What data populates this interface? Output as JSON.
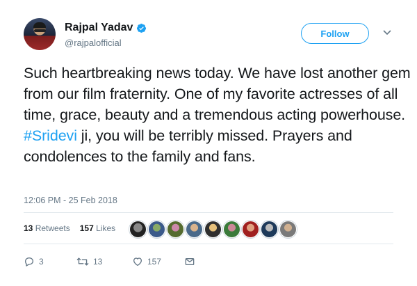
{
  "author": {
    "name": "Rajpal Yadav",
    "handle": "@rajpalofficial",
    "verified": true
  },
  "follow_label": "Follow",
  "tweet": {
    "text_before": "Such heartbreaking news today. We have lost another gem from our film fraternity. One of my favorite actresses of all time, grace, beauty and a tremendous acting powerhouse. ",
    "hashtag": "#Sridevi",
    "text_after": " ji, you will be terribly missed. Prayers and condolences to the family and fans."
  },
  "timestamp": "12:06 PM - 25 Feb 2018",
  "stats": {
    "retweets_count": "13",
    "retweets_label": "Retweets",
    "likes_count": "157",
    "likes_label": "Likes"
  },
  "likers_count": 9,
  "actions": {
    "reply_count": "3",
    "retweet_count": "13",
    "like_count": "157"
  },
  "colors": {
    "accent": "#1da1f2",
    "secondary_text": "#657786",
    "divider": "#e1e8ed"
  },
  "icons": [
    "verified-badge-icon",
    "chevron-down-icon",
    "reply-icon",
    "retweet-icon",
    "heart-icon",
    "envelope-icon"
  ]
}
